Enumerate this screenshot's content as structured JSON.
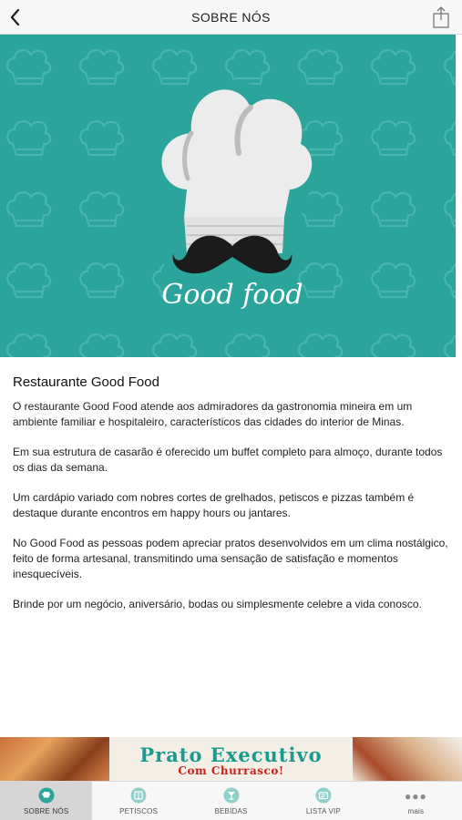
{
  "header": {
    "title": "SOBRE NÓS"
  },
  "hero": {
    "logo_text": "Good food",
    "background_color": "#2ba49c"
  },
  "article": {
    "heading": "Restaurante Good Food",
    "paragraphs": [
      "O restaurante Good Food atende aos admiradores da gastronomia mineira em um ambiente familiar e hospitaleiro, característicos das cidades do interior de Minas.",
      "Em sua estrutura de casarão é oferecido um buffet completo para almoço, durante todos os dias da semana.",
      "Um cardápio variado com nobres cortes de grelhados, petiscos e pizzas também é destaque durante encontros em happy hours ou jantares.",
      "No Good Food as pessoas podem apreciar pratos desenvolvidos em um clima nostálgico, feito de forma artesanal, transmitindo uma sensação de satisfação e momentos inesquecíveis.",
      "Brinde por um negócio, aniversário, bodas ou simplesmente celebre a vida conosco."
    ]
  },
  "ad": {
    "line1": "Prato Executivo",
    "line2": "Com Churrasco!",
    "colors": {
      "line1": "#1b9a8f",
      "line2": "#c8211b"
    }
  },
  "tabs": [
    {
      "label": "SOBRE NÓS",
      "icon": "chef-hat-icon",
      "active": true
    },
    {
      "label": "PETISCOS",
      "icon": "menu-book-icon",
      "active": false
    },
    {
      "label": "BEBIDAS",
      "icon": "drinks-icon",
      "active": false
    },
    {
      "label": "LISTA VIP",
      "icon": "vip-list-icon",
      "active": false
    },
    {
      "label": "mais",
      "icon": "more-dots-icon",
      "active": false
    }
  ],
  "accent_color": "#2ba49c"
}
